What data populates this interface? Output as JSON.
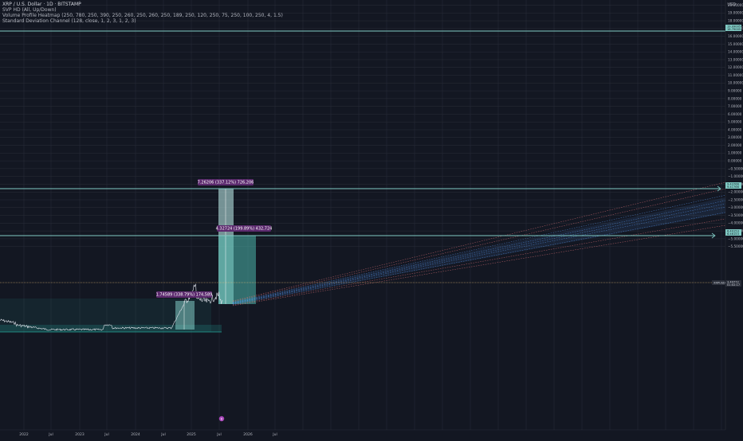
{
  "legend": {
    "title": "XRP / U.S. Dollar · 1D · BITSTAMP",
    "lines": [
      "SVP HD (All, Up/Down)",
      "Volume Profile Heatmap (250, 780, 250, 390, 250, 260, 250, 260, 250, 189, 250, 120, 250, 75, 250, 100, 250, 4, 1.5)",
      "Standard Deviation Channel (128, close, 1, 2, 3, 1, 2, 3)"
    ]
  },
  "currency": "USD",
  "x_axis": [
    "2022",
    "Jul",
    "2023",
    "Jul",
    "2024",
    "Jul",
    "2025",
    "Jul",
    "2026",
    "Jul"
  ],
  "y_axis": [
    "20.00000",
    "19.00000",
    "18.00000",
    "17.00000",
    "16.00000",
    "15.00000",
    "14.00000",
    "13.00000",
    "12.00000",
    "11.00000",
    "10.00000",
    "9.00000",
    "8.00000",
    "7.00000",
    "6.00000",
    "5.00000",
    "4.00000",
    "3.00000",
    "2.00000",
    "1.00000",
    "0.00000",
    "−0.50000",
    "−1.00000",
    "−1.50000",
    "−2.00000",
    "−2.50000",
    "−3.00000",
    "−3.50000",
    "−4.00000",
    "−4.50000",
    "−5.00000",
    "−5.50000"
  ],
  "measurements": [
    "7.26206 (337.12%) 726,206",
    "4.32724 (199.89%) 432,724",
    "1.74589 (338.79%) 174,589"
  ],
  "price_tags": {
    "top": [
      "19.09005",
      "18.79005"
    ],
    "upper": [
      "9.43766",
      "9.41766"
    ],
    "mid": [
      "6.49153",
      "6.46153"
    ],
    "current": [
      "3.49772",
      "01:02:17"
    ],
    "current_left": "XRPUSD"
  },
  "colors": {
    "background": "#131722",
    "grid": "#2a2e39",
    "price": "#e0e3eb",
    "target_line": "#80cbc4",
    "channel_blue": "#5b9cf6",
    "channel_red": "#f77c80",
    "callout": "#5c2a6e"
  },
  "event_marker": "e"
}
